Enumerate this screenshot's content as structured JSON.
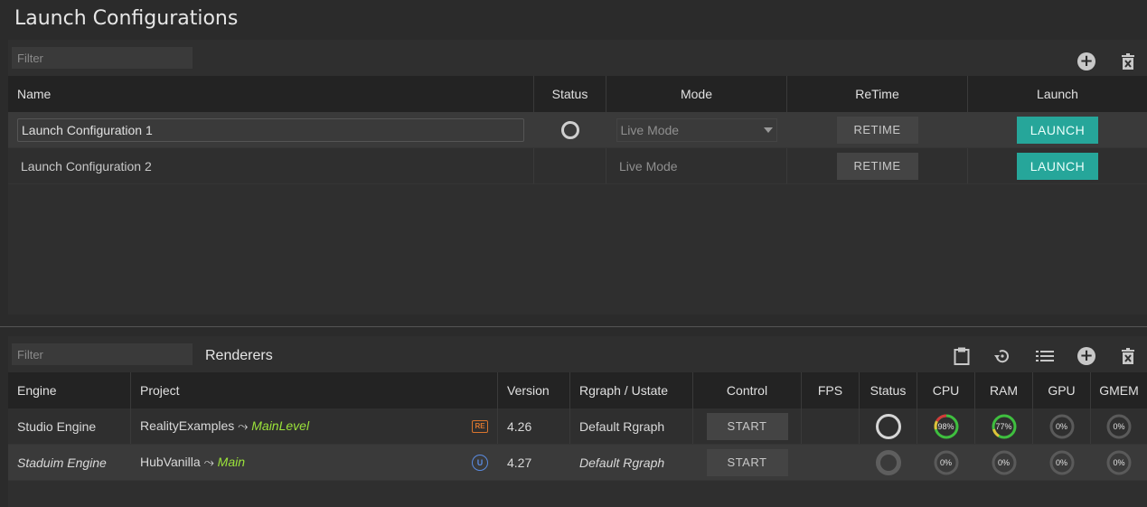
{
  "page_title": "Launch Configurations",
  "launch": {
    "filter_placeholder": "Filter",
    "columns": [
      "Name",
      "Status",
      "Mode",
      "ReTime",
      "Launch"
    ],
    "rows": [
      {
        "name": "Launch Configuration 1",
        "mode": "Live Mode",
        "retime": "RETIME",
        "launch": "LAUNCH"
      },
      {
        "name": "Launch Configuration 2",
        "mode": "Live Mode",
        "retime": "RETIME",
        "launch": "LAUNCH"
      }
    ]
  },
  "renderers": {
    "filter_placeholder": "Filter",
    "title": "Renderers",
    "columns": [
      "Engine",
      "Project",
      "Version",
      "Rgraph / Ustate",
      "Control",
      "FPS",
      "Status",
      "CPU",
      "RAM",
      "GPU",
      "GMEM"
    ],
    "rows": [
      {
        "engine": "Studio Engine",
        "project": "RealityExamples",
        "arrow": "⤳",
        "level": "MainLevel",
        "engine_icon": "reality-engine-icon",
        "version": "4.26",
        "rgraph": "Default Rgraph",
        "control": "START",
        "fps": "",
        "cpu": "98%",
        "ram": "77%",
        "gpu": "0%",
        "gmem": "0%"
      },
      {
        "engine": "Staduim Engine",
        "project": "HubVanilla",
        "arrow": "⤳",
        "level": "Main",
        "engine_icon": "unreal-engine-icon",
        "version": "4.27",
        "rgraph": "Default Rgraph",
        "control": "START",
        "fps": "",
        "cpu": "0%",
        "ram": "0%",
        "gpu": "0%",
        "gmem": "0%"
      }
    ]
  },
  "colors": {
    "accent_teal": "#26a69a",
    "level_green": "#9be23a",
    "gauge_green": "#3fbf3f",
    "gauge_red": "#d23a3a",
    "gauge_yellow": "#e0c23a"
  }
}
